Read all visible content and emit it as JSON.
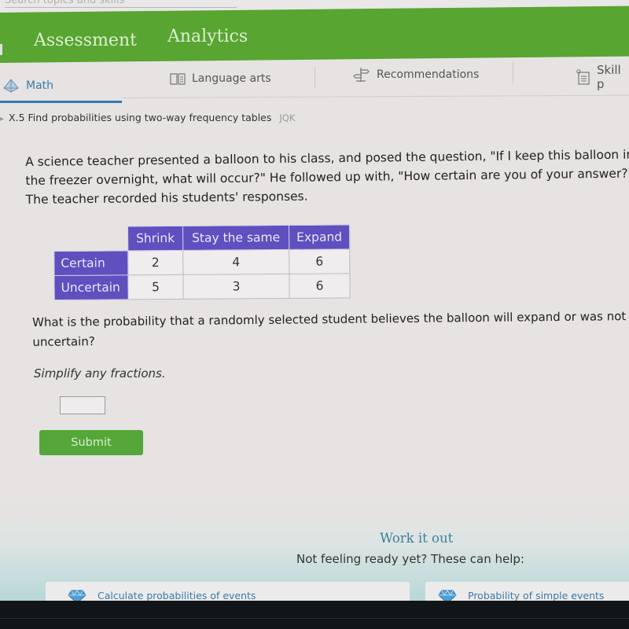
{
  "search": {
    "placeholder": "Search topics and skills"
  },
  "nav": {
    "items": [
      {
        "label": "Assessment"
      },
      {
        "label": "Analytics"
      }
    ]
  },
  "subjects": {
    "tabs": [
      {
        "label": "Math",
        "icon": "pyramid-icon",
        "active": true
      },
      {
        "label": "Language arts",
        "icon": "book-icon"
      },
      {
        "label": "Recommendations",
        "icon": "signpost-icon"
      },
      {
        "label": "Skill p",
        "icon": "checklist-icon"
      }
    ]
  },
  "breadcrumb": {
    "skill": "X.5 Find probabilities using two-way frequency tables",
    "code": "JQK"
  },
  "question": {
    "intro": "A science teacher presented a balloon to his class, and posed the question, \"If I keep this balloon in the freezer overnight, what will occur?\" He followed up with, \"How certain are you of your answer?\" The teacher recorded his students' responses.",
    "table": {
      "columns": [
        "Shrink",
        "Stay the same",
        "Expand"
      ],
      "rows": [
        {
          "label": "Certain",
          "values": [
            "2",
            "4",
            "6"
          ]
        },
        {
          "label": "Uncertain",
          "values": [
            "5",
            "3",
            "6"
          ]
        }
      ]
    },
    "prompt": "What is the probability that a randomly selected student believes the balloon will expand or was not uncertain?",
    "instruction": "Simplify any fractions.",
    "answer_value": "",
    "submit_label": "Submit"
  },
  "help": {
    "title": "Work it out",
    "subtitle": "Not feeling ready yet? These can help:",
    "cards": [
      {
        "label": "Calculate probabilities of events",
        "icon": "gem-icon"
      },
      {
        "label": "Probability of simple events",
        "icon": "gem-icon"
      }
    ]
  }
}
